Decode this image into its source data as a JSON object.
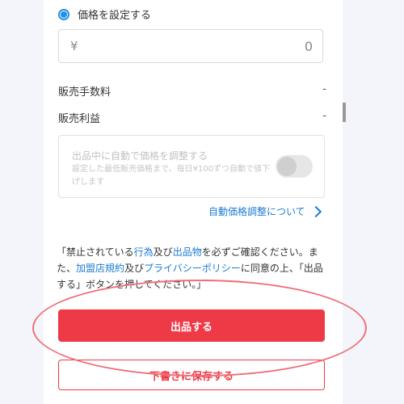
{
  "price_option": {
    "label": "価格を設定する",
    "selected": true
  },
  "price_input": {
    "currency": "¥",
    "value": "0"
  },
  "fees": {
    "commission_label": "販売手数料",
    "commission_value": "-",
    "profit_label": "販売利益",
    "profit_value": "-"
  },
  "auto_adjust": {
    "title": "出品中に自動で価格を調整する",
    "description": "設定した最低販売価格まで、毎日¥100ずつ自動で値下げします",
    "enabled": false
  },
  "about_link": "自動価格調整について",
  "notice": {
    "p1": "「禁止されている",
    "link1": "行為",
    "p2": "及び",
    "link2": "出品物",
    "p3": "を必ずご確認ください。また、",
    "link3": "加盟店規約",
    "p4": "及び",
    "link4": "プライバシーポリシー",
    "p5": "に同意の上、「出品する」ボタンを押してください。」"
  },
  "buttons": {
    "submit": "出品する",
    "draft": "下書きに保存する"
  },
  "colors": {
    "accent": "#1e90e6",
    "primary_red": "#ee3a47",
    "link": "#1e7bd2",
    "annotation": "#ef6f78"
  }
}
